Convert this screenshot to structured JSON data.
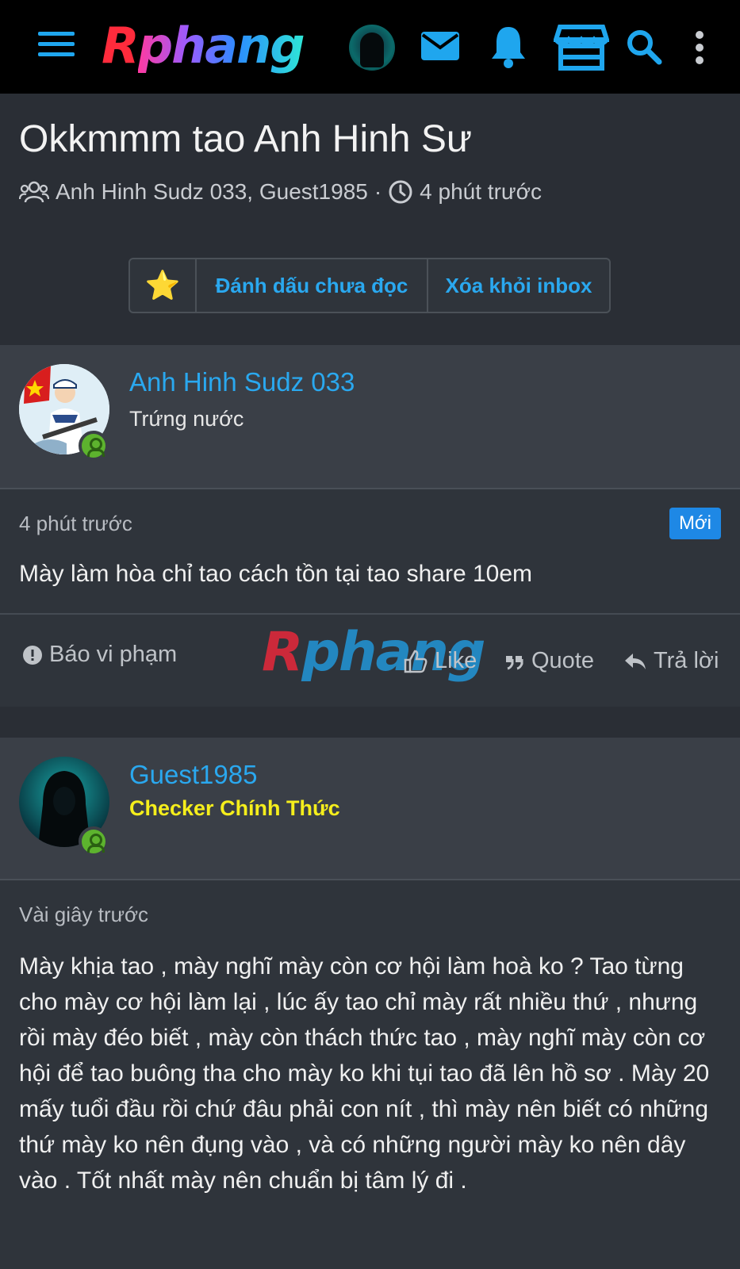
{
  "header": {
    "logo_text": "Rphang",
    "logo_first": "R",
    "logo_rest": "phang",
    "icons": [
      "menu-icon",
      "avatar",
      "envelope-icon",
      "bell-icon",
      "store-icon",
      "search-icon",
      "more-vertical-icon"
    ]
  },
  "thread": {
    "title": "Okkmmm tao Anh Hinh Sư",
    "participants": "Anh Hinh Sudz 033, Guest1985",
    "separator": "·",
    "time": "4 phút trước",
    "actions": {
      "star_icon": "⭐",
      "mark_unread": "Đánh dấu chưa đọc",
      "remove_inbox": "Xóa khỏi inbox"
    }
  },
  "posts": [
    {
      "author": "Anh Hinh Sudz 033",
      "role": "Trứng nước",
      "role_color": "#e6e6e6",
      "time": "4 phút trước",
      "badge": "Mới",
      "body": "Mày làm hòa chỉ tao cách tồn tại tao share 10em",
      "actions": {
        "report": "Báo vi phạm",
        "like": "Like",
        "quote": "Quote",
        "reply": "Trả lời"
      },
      "watermark_first": "R",
      "watermark_rest": "phang"
    },
    {
      "author": "Guest1985",
      "role": "Checker Chính Thức",
      "role_color": "#f5ee1c",
      "time": "Vài giây trước",
      "body": "Mày khịa tao , mày nghĩ mày còn cơ hội làm hoà ko ? Tao từng cho mày cơ hội làm lại , lúc ấy tao chỉ mày rất nhiều thứ , nhưng rồi mày đéo biết , mày còn thách thức tao , mày nghĩ mày còn cơ hội để tao buông tha cho mày ko khi tụi tao đã lên hồ sơ . Mày 20 mấy tuổi đầu rồi chứ đâu phải con nít , thì mày nên biết có những thứ mày ko nên đụng vào , và có những người mày ko nên dây vào . Tốt nhất mày nên chuẩn bị tâm lý đi ."
    }
  ],
  "colors": {
    "accent": "#2aa8ef",
    "background": "#2a2e35",
    "online": "#5db32e"
  }
}
